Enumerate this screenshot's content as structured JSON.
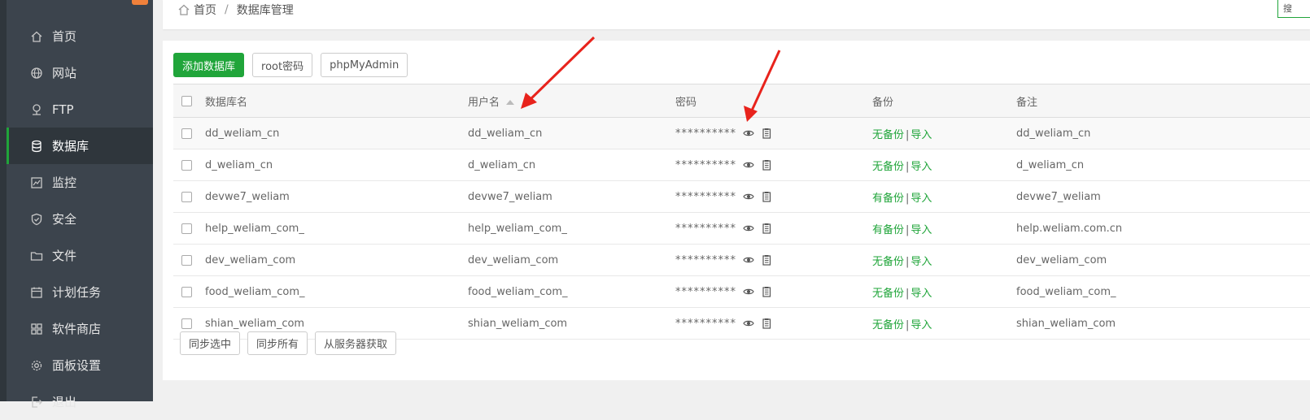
{
  "sidebar": {
    "items": [
      {
        "label": "首页",
        "icon": "home-icon",
        "active": false
      },
      {
        "label": "网站",
        "icon": "globe-icon",
        "active": false
      },
      {
        "label": "FTP",
        "icon": "ftp-icon",
        "active": false
      },
      {
        "label": "数据库",
        "icon": "database-icon",
        "active": true
      },
      {
        "label": "监控",
        "icon": "monitor-icon",
        "active": false
      },
      {
        "label": "安全",
        "icon": "shield-icon",
        "active": false
      },
      {
        "label": "文件",
        "icon": "folder-icon",
        "active": false
      },
      {
        "label": "计划任务",
        "icon": "calendar-icon",
        "active": false
      },
      {
        "label": "软件商店",
        "icon": "apps-icon",
        "active": false
      },
      {
        "label": "面板设置",
        "icon": "gear-icon",
        "active": false
      },
      {
        "label": "退出",
        "icon": "logout-icon",
        "active": false
      }
    ]
  },
  "breadcrumb": {
    "home": "首页",
    "separator": "/",
    "current": "数据库管理"
  },
  "search_stub": "搜",
  "toolbar": {
    "add": "添加数据库",
    "root": "root密码",
    "pma": "phpMyAdmin"
  },
  "table": {
    "headers": {
      "name": "数据库名",
      "user": "用户名",
      "password": "密码",
      "backup": "备份",
      "note": "备注"
    },
    "rows": [
      {
        "name": "dd_weliam_cn",
        "user": "dd_weliam_cn",
        "password": "**********",
        "backup": "无备份",
        "import": "导入",
        "note": "dd_weliam_cn"
      },
      {
        "name": "d_weliam_cn",
        "user": "d_weliam_cn",
        "password": "**********",
        "backup": "无备份",
        "import": "导入",
        "note": "d_weliam_cn"
      },
      {
        "name": "devwe7_weliam",
        "user": "devwe7_weliam",
        "password": "**********",
        "backup": "有备份",
        "import": "导入",
        "note": "devwe7_weliam"
      },
      {
        "name": "help_weliam_com_",
        "user": "help_weliam_com_",
        "password": "**********",
        "backup": "有备份",
        "import": "导入",
        "note": "help.weliam.com.cn"
      },
      {
        "name": "dev_weliam_com",
        "user": "dev_weliam_com",
        "password": "**********",
        "backup": "无备份",
        "import": "导入",
        "note": "dev_weliam_com"
      },
      {
        "name": "food_weliam_com_",
        "user": "food_weliam_com_",
        "password": "**********",
        "backup": "无备份",
        "import": "导入",
        "note": "food_weliam_com_"
      },
      {
        "name": "shian_weliam_com",
        "user": "shian_weliam_com",
        "password": "**********",
        "backup": "无备份",
        "import": "导入",
        "note": "shian_weliam_com"
      }
    ]
  },
  "bottom": {
    "sync_selected": "同步选中",
    "sync_all": "同步所有",
    "fetch_server": "从服务器获取"
  },
  "colors": {
    "accent": "#20a53a",
    "sidebar": "#3c444d",
    "arrow": "#e8231c"
  }
}
